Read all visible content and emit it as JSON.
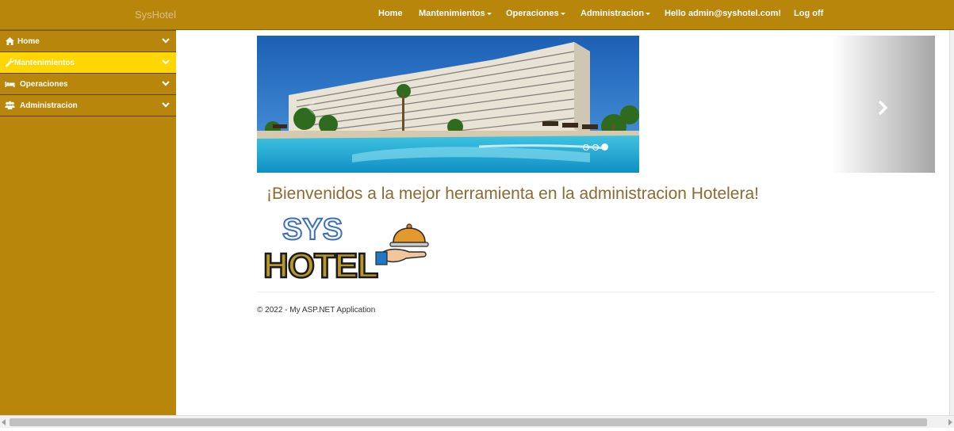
{
  "navbar": {
    "brand": "SysHotel",
    "items": [
      {
        "label": "Home",
        "dropdown": false
      },
      {
        "label": "Mantenimientos",
        "dropdown": true
      },
      {
        "label": "Operaciones",
        "dropdown": true
      },
      {
        "label": "Administracion",
        "dropdown": true
      },
      {
        "label": "Hello admin@syshotel.com!",
        "dropdown": false
      },
      {
        "label": "Log off",
        "dropdown": false
      }
    ]
  },
  "sidebar": {
    "items": [
      {
        "label": "Home",
        "icon": "home-icon",
        "active": false
      },
      {
        "label": "Mantenimientos",
        "icon": "wrench-icon",
        "active": true
      },
      {
        "label": "Operaciones",
        "icon": "bed-icon",
        "active": false
      },
      {
        "label": "Administracion",
        "icon": "users-icon",
        "active": false
      }
    ]
  },
  "carousel": {
    "slide_count": 3,
    "active_index": 2
  },
  "main": {
    "welcome": "¡Bienvenidos a la mejor herramienta en la administracion Hotelera!",
    "logo_text_top": "SYS",
    "logo_text_bottom": "HOTEL"
  },
  "footer": {
    "text": "© 2022 - My ASP.NET Application"
  },
  "colors": {
    "navbar": "#b8860b",
    "active_item": "#ffd700",
    "welcome_text": "#8b6a2f"
  }
}
